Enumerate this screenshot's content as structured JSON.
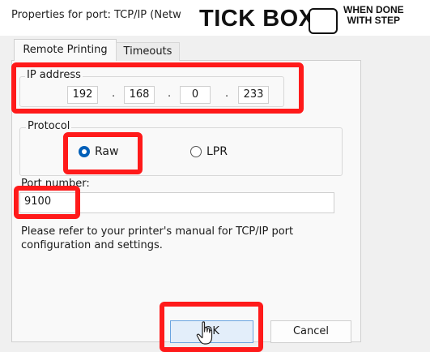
{
  "window": {
    "title": "Properties for port: TCP/IP (Netw"
  },
  "overlay": {
    "tick_label": "TICK BOX",
    "tick_note_line1": "WHEN DONE",
    "tick_note_line2": "WITH STEP",
    "highlight_color": "#ff1a1a"
  },
  "tabs": [
    {
      "label": "Remote Printing",
      "active": true
    },
    {
      "label": "Timeouts",
      "active": false
    }
  ],
  "ip": {
    "label": "IP address",
    "octets": [
      "192",
      "168",
      "0",
      "233"
    ],
    "separator": "."
  },
  "protocol": {
    "label": "Protocol",
    "options": [
      {
        "label": "Raw",
        "selected": true
      },
      {
        "label": "LPR",
        "selected": false
      }
    ],
    "accent": "#005fb8"
  },
  "port": {
    "label": "Port number:",
    "value": "9100"
  },
  "help": {
    "text": "Please refer to your printer's manual for TCP/IP port configuration and settings."
  },
  "buttons": {
    "ok": "OK",
    "cancel": "Cancel"
  },
  "icons": {
    "cursor": "hand-pointer-icon"
  }
}
